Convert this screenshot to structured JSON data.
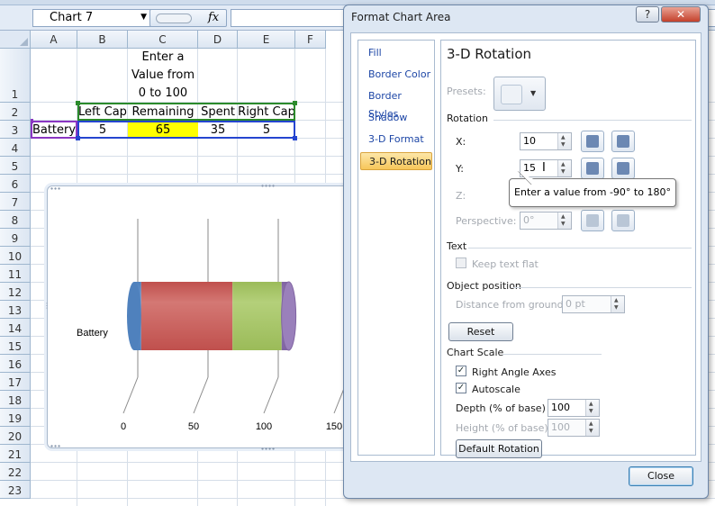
{
  "formula_bar": {
    "name_box": "Chart 7",
    "fx": "fx"
  },
  "columns": [
    "A",
    "B",
    "C",
    "D",
    "E",
    "F"
  ],
  "rows": [
    "1",
    "2",
    "3",
    "4",
    "5",
    "6",
    "7",
    "8",
    "9",
    "10",
    "11",
    "12",
    "13",
    "14",
    "15",
    "16",
    "17",
    "18",
    "19",
    "20",
    "21",
    "22",
    "23"
  ],
  "cells": {
    "c1": [
      "Enter a",
      "Value from",
      "0 to 100"
    ],
    "headers": [
      "Left Cap",
      "Remaining",
      "Spent",
      "Right Cap"
    ],
    "row3_label": "Battery",
    "row3_values": [
      "5",
      "65",
      "35",
      "5"
    ]
  },
  "colors": {
    "yellow_cell": "#ffff00",
    "left_cap": "#4f81bd",
    "remaining": "#c0504d",
    "spent": "#9bbb59",
    "right_cap": "#8064a2"
  },
  "chart_data": {
    "type": "bar",
    "orientation": "horizontal",
    "stacked": true,
    "three_d": true,
    "categories": [
      "Battery"
    ],
    "series": [
      {
        "name": "Left Cap",
        "values": [
          5
        ]
      },
      {
        "name": "Remaining",
        "values": [
          65
        ]
      },
      {
        "name": "Spent",
        "values": [
          35
        ]
      },
      {
        "name": "Right Cap",
        "values": [
          5
        ]
      }
    ],
    "x_ticks": [
      "0",
      "50",
      "100",
      "150"
    ],
    "xlim": [
      0,
      150
    ],
    "grid": true
  },
  "dialog": {
    "title": "Format Chart Area",
    "help": "?",
    "close_x": "✕",
    "nav": [
      "Fill",
      "Border Color",
      "Border Styles",
      "Shadow",
      "3-D Format",
      "3-D Rotation"
    ],
    "active_nav": "3-D Rotation",
    "panel_title": "3-D Rotation",
    "presets_label": "Presets:",
    "rotation_label": "Rotation",
    "x_label": "X:",
    "x_value": "10",
    "y_label": "Y:",
    "y_value": "15",
    "z_label": "Z:",
    "perspective_label": "Perspective:",
    "perspective_value": "0°",
    "tooltip": "Enter a value from -90° to 180°",
    "text_label": "Text",
    "keep_text_flat": "Keep text flat",
    "object_position_label": "Object position",
    "distance_label": "Distance from ground:",
    "distance_value": "0 pt",
    "reset": "Reset",
    "chart_scale_label": "Chart Scale",
    "right_angle_axes": "Right Angle Axes",
    "autoscale": "Autoscale",
    "depth_label": "Depth (% of base)",
    "depth_value": "100",
    "height_label": "Height (% of base)",
    "height_value": "100",
    "default_rotation": "Default Rotation",
    "close": "Close"
  }
}
